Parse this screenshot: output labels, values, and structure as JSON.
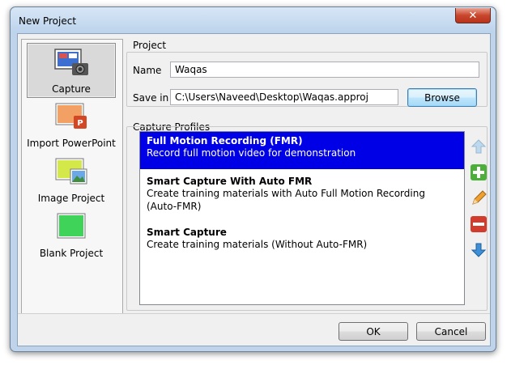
{
  "window": {
    "title": "New Project",
    "close_glyph": "✕"
  },
  "left_pane": {
    "items": [
      {
        "label": "Capture",
        "icon": "capture-camera-icon",
        "selected": true
      },
      {
        "label": "Import PowerPoint",
        "icon": "powerpoint-icon",
        "selected": false
      },
      {
        "label": "Image Project",
        "icon": "image-icon",
        "selected": false
      },
      {
        "label": "Blank Project",
        "icon": "blank-project-icon",
        "selected": false
      }
    ]
  },
  "project": {
    "group_label": "Project",
    "name_label": "Name",
    "name_value": "Waqas",
    "save_in_label": "Save in",
    "save_in_value": "C:\\Users\\Naveed\\Desktop\\Waqas.approj",
    "browse_label": "Browse"
  },
  "capture_profiles": {
    "group_label": "Capture Profiles",
    "items": [
      {
        "name": "Full Motion Recording (FMR)",
        "desc": [
          "Record full motion video for demonstration"
        ],
        "selected": true
      },
      {
        "name": "Smart Capture With Auto FMR",
        "desc": [
          "Create training materials with Auto Full Motion Recording",
          "(Auto-FMR)"
        ],
        "selected": false
      },
      {
        "name": "Smart Capture",
        "desc": [
          "Create training materials (Without Auto-FMR)"
        ],
        "selected": false
      }
    ],
    "side_buttons": [
      "move-up-icon",
      "add-icon",
      "edit-icon",
      "remove-icon",
      "move-down-icon"
    ]
  },
  "footer": {
    "ok_label": "OK",
    "cancel_label": "Cancel"
  },
  "colors": {
    "selection": "#0000e6",
    "window_frame": "#bfd4ea",
    "close_button": "#c9462c"
  }
}
